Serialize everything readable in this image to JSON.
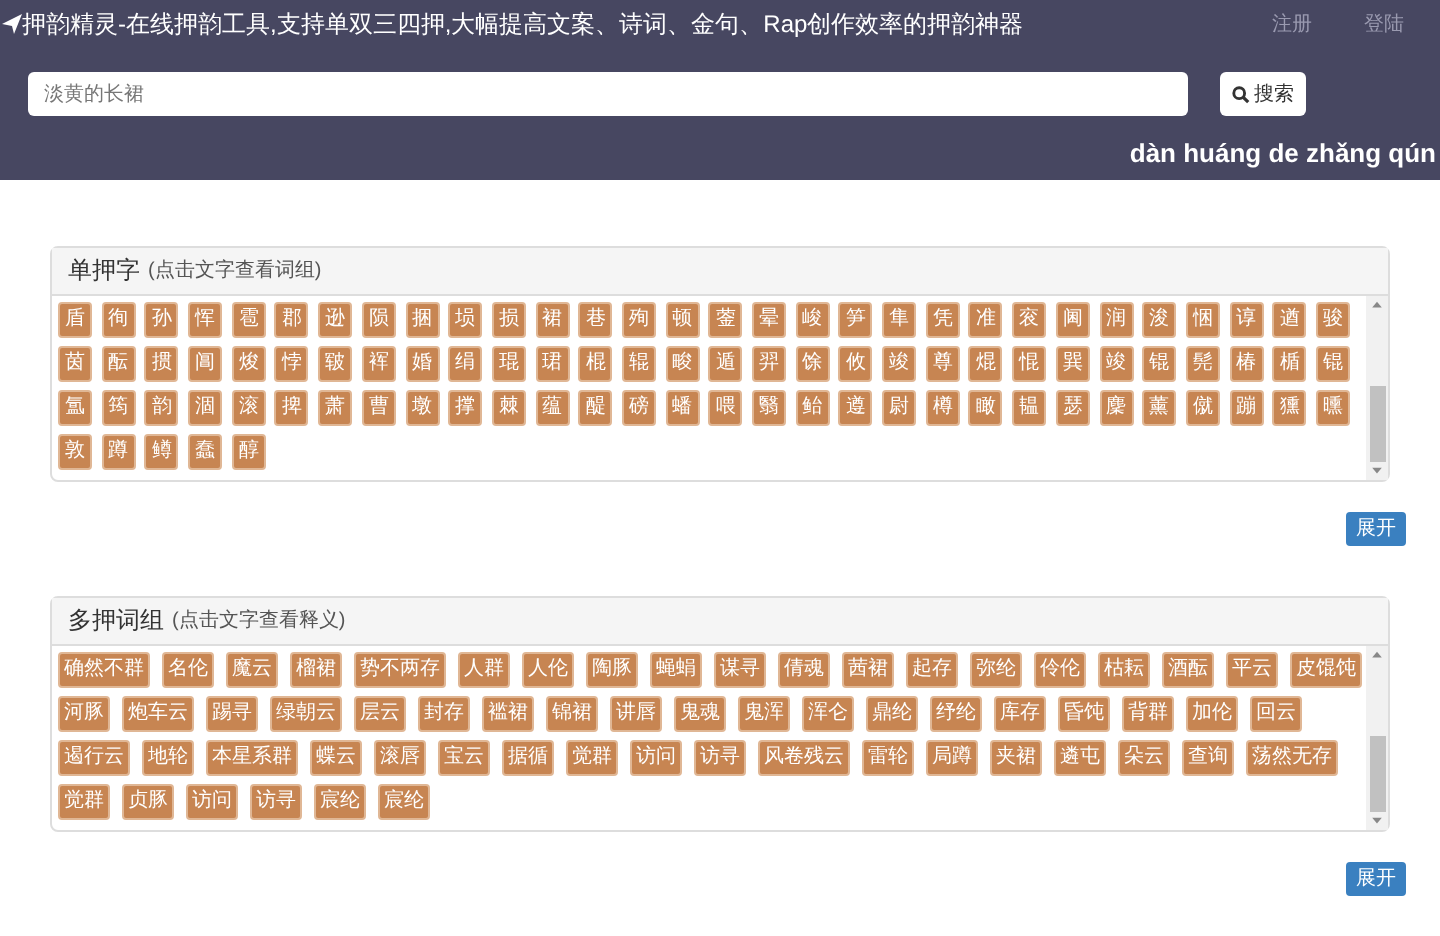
{
  "header": {
    "title": "押韵精灵-在线押韵工具,支持单双三四押,大幅提高文案、诗词、金句、Rap创作效率的押韵神器",
    "links": [
      "注册",
      "登陆"
    ]
  },
  "search": {
    "placeholder": "淡黄的长裙",
    "button": "搜索"
  },
  "pinyin": "dàn huáng de zhǎng qún",
  "panels": [
    {
      "title": "单押字",
      "hint": "(点击文字查看词组)",
      "kind": "chars",
      "expand": "展开",
      "items": [
        "盾",
        "徇",
        "孙",
        "恽",
        "雹",
        "郡",
        "逊",
        "陨",
        "捆",
        "埙",
        "损",
        "裙",
        "巷",
        "殉",
        "顿",
        "蓥",
        "晕",
        "峻",
        "笋",
        "隼",
        "凭",
        "准",
        "衮",
        "阃",
        "润",
        "浚",
        "悃",
        "谆",
        "遒",
        "骏",
        "茵",
        "酝",
        "掼",
        "阊",
        "焌",
        "悖",
        "皲",
        "裈",
        "婚",
        "绢",
        "琨",
        "珺",
        "棍",
        "辊",
        "畯",
        "遁",
        "羿",
        "馀",
        "攸",
        "竣",
        "尊",
        "焜",
        "惃",
        "巽",
        "竣",
        "锟",
        "髡",
        "椿",
        "楯",
        "锟",
        "氲",
        "筠",
        "韵",
        "涸",
        "滚",
        "捭",
        "萧",
        "曹",
        "墩",
        "撑",
        "棘",
        "蕴",
        "醍",
        "磅",
        "蟠",
        "喂",
        "翳",
        "鲐",
        "遵",
        "尉",
        "樽",
        "瞰",
        "韫",
        "瑟",
        "麇",
        "薰",
        "僦",
        "蹦",
        "獯",
        "曛",
        "敦",
        "蹲",
        "鳟",
        "蠢",
        "醇"
      ]
    },
    {
      "title": "多押词组",
      "hint": "(点击文字查看释义)",
      "kind": "words",
      "expand": "展开",
      "items": [
        "确然不群",
        "名伦",
        "魔云",
        "榴裙",
        "势不两存",
        "人群",
        "人伦",
        "陶豚",
        "蝇蜎",
        "谋寻",
        "倩魂",
        "茜裙",
        "起存",
        "弥纶",
        "伶伦",
        "枯耘",
        "酒酝",
        "平云",
        "皮馄饨",
        "河豚",
        "炮车云",
        "踢寻",
        "绿朝云",
        "层云",
        "封存",
        "褴裙",
        "锦裙",
        "讲唇",
        "鬼魂",
        "鬼浑",
        "浑仑",
        "鼎纶",
        "纾纶",
        "库存",
        "昏饨",
        "背群",
        "加伦",
        "回云",
        "遏行云",
        "地轮",
        "本星系群",
        "蝶云",
        "滚唇",
        "宝云",
        "据循",
        "觉群",
        "访问",
        "访寻",
        "风卷残云",
        "雷轮",
        "局蹲",
        "夹裙",
        "遴屯",
        "朵云",
        "查询",
        "荡然无存",
        "觉群",
        "贞豚",
        "访问",
        "访寻",
        "宸纶",
        "宸纶"
      ]
    }
  ]
}
